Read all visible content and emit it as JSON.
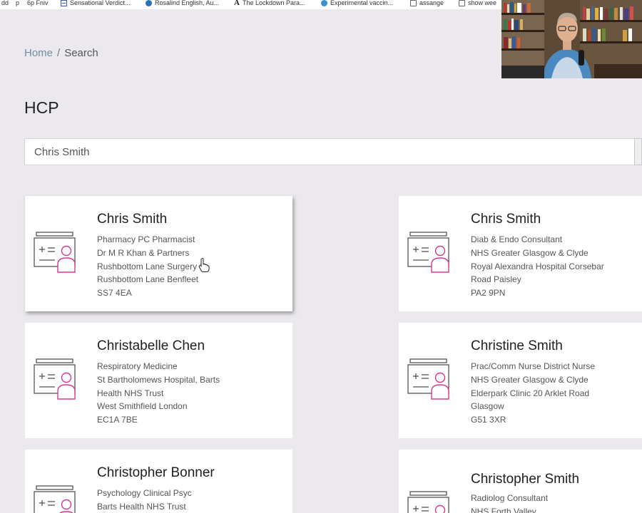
{
  "bookmarks": [
    {
      "label": "dd",
      "icon": "none"
    },
    {
      "label": "p",
      "icon": "none"
    },
    {
      "label": "6p Fniv",
      "icon": "none"
    },
    {
      "label": "Sensational Verdict...",
      "icon": "calendar-icon"
    },
    {
      "label": "Rosalind English, Au...",
      "icon": "wordpress-icon"
    },
    {
      "label": "The Lockdown Para...",
      "icon": "atlantic-icon"
    },
    {
      "label": "Experimental vaccin...",
      "icon": "globe-icon"
    },
    {
      "label": "assange",
      "icon": "folder-icon"
    },
    {
      "label": "show wee",
      "icon": "folder-icon"
    }
  ],
  "breadcrumb": {
    "home": "Home",
    "separator": "/",
    "current": "Search"
  },
  "page": {
    "title": "HCP"
  },
  "search": {
    "value": "Chris Smith"
  },
  "colors": {
    "accent_pink": "#d6388e",
    "icon_gray": "#555555",
    "link": "#6f8fa3"
  },
  "cards": [
    {
      "name": "Chris Smith",
      "lines": [
        "Pharmacy PC Pharmacist",
        "Dr M R Khan & Partners",
        "Rushbottom Lane Surgery 1",
        "Rushbottom Lane Benfleet",
        "SS7 4EA"
      ]
    },
    {
      "name": "Chris Smith",
      "lines": [
        "Diab & Endo Consultant",
        "NHS Greater Glasgow & Clyde",
        "Royal Alexandra Hospital Corsebar",
        "Road Paisley",
        "PA2 9PN"
      ]
    },
    {
      "name": "Christabelle Chen",
      "lines": [
        "Respiratory Medicine",
        "St Bartholomews Hospital, Barts",
        "Health NHS Trust",
        "West Smithfield London",
        "EC1A 7BE"
      ]
    },
    {
      "name": "Christine Smith",
      "lines": [
        "Prac/Comm Nurse District Nurse",
        "NHS Greater Glasgow & Clyde",
        "Elderpark Clinic 20 Arklet Road",
        "Glasgow",
        "G51 3XR"
      ]
    },
    {
      "name": "Christopher Bonner",
      "lines": [
        "Psychology Clinical Psyc",
        "Barts Health NHS Trust",
        "",
        "",
        ""
      ]
    },
    {
      "name": "Christopher Smith",
      "lines": [
        "Radiolog Consultant",
        "NHS Forth Valley",
        "",
        "",
        ""
      ]
    }
  ]
}
